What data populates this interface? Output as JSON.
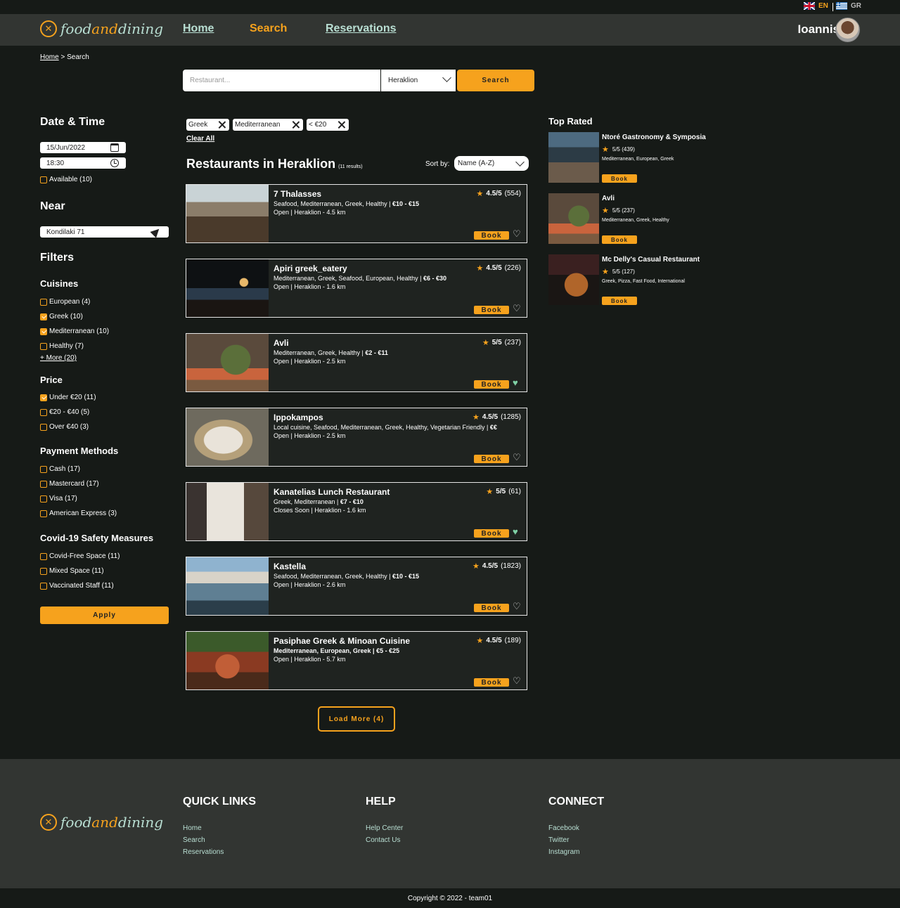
{
  "languages": [
    {
      "code": "EN",
      "active": true
    },
    {
      "code": "GR",
      "active": false
    }
  ],
  "header": {
    "logo": {
      "pre": "food",
      "mid": "and",
      "post": "dining"
    },
    "nav": [
      {
        "label": "Home",
        "active": false
      },
      {
        "label": "Search",
        "active": true
      },
      {
        "label": "Reservations",
        "active": false
      }
    ],
    "user_name": "Ioannis"
  },
  "breadcrumb": {
    "home": "Home",
    "sep": " > ",
    "current": "Search"
  },
  "search": {
    "placeholder": "Restaurant...",
    "city": "Heraklion",
    "button": "Search"
  },
  "sidebar": {
    "datetime_title": "Date & Time",
    "date": "15/Jun/2022",
    "time": "18:30",
    "available": {
      "label": "Available (10)",
      "checked": false
    },
    "near_title": "Near",
    "near_value": "Kondilaki 71",
    "filters_title": "Filters",
    "cuisines_title": "Cuisines",
    "cuisines": [
      {
        "label": "European (4)",
        "checked": false
      },
      {
        "label": "Greek (10)",
        "checked": true
      },
      {
        "label": "Mediterranean (10)",
        "checked": true
      },
      {
        "label": "Healthy (7)",
        "checked": false
      }
    ],
    "more": "+ More (20)",
    "price_title": "Price",
    "prices": [
      {
        "label": "Under €20 (11)",
        "checked": true
      },
      {
        "label": "€20 - €40 (5)",
        "checked": false
      },
      {
        "label": "Over €40 (3)",
        "checked": false
      }
    ],
    "payment_title": "Payment Methods",
    "payments": [
      {
        "label": "Cash (17)",
        "checked": false
      },
      {
        "label": "Mastercard (17)",
        "checked": false
      },
      {
        "label": "Visa (17)",
        "checked": false
      },
      {
        "label": "American Express (3)",
        "checked": false
      }
    ],
    "covid_title": "Covid-19 Safety Measures",
    "covid": [
      {
        "label": "Covid-Free Space (11)",
        "checked": false
      },
      {
        "label": "Mixed Space (11)",
        "checked": false
      },
      {
        "label": "Vaccinated Staff (11)",
        "checked": false
      }
    ],
    "apply": "Apply"
  },
  "chips": [
    "Greek",
    "Mediterranean",
    "< €20"
  ],
  "clear_all": "Clear All",
  "results": {
    "title": "Restaurants in Heraklion",
    "count": "(11 results)",
    "sort_label": "Sort by:",
    "sort_value": "Name (A-Z)"
  },
  "restaurants": [
    {
      "name": "7 Thalasses",
      "cats": "Seafood, Mediterranean, Greek, Healthy | ",
      "price": "€10 - €15",
      "status": "Open | Heraklion - 4.5 km",
      "score": "4.5/5",
      "reviews": "(554)",
      "fav": false
    },
    {
      "name": "Apiri greek_eatery",
      "cats": "Mediterranean, Greek, Seafood, European, Healthy | ",
      "price": "€6 - €30",
      "status": "Open | Heraklion - 1.6 km",
      "score": "4.5/5",
      "reviews": "(226)",
      "fav": false
    },
    {
      "name": "Avli",
      "cats": "Mediterranean, Greek, Healthy | ",
      "price": "€2 - €11",
      "status": "Open | Heraklion - 2.5 km",
      "score": "5/5",
      "reviews": "(237)",
      "fav": true
    },
    {
      "name": "Ippokampos",
      "cats": "Local cuisine, Seafood, Mediterranean, Greek, Healthy, Vegetarian Friendly | ",
      "price": "€€",
      "status": "Open | Heraklion - 2.5 km",
      "score": "4.5/5",
      "reviews": "(1285)",
      "fav": false
    },
    {
      "name": "Kanatelias Lunch Restaurant",
      "cats": "Greek, Mediterranean | ",
      "price": "€7 - €10",
      "status": "Closes Soon | Heraklion - 1.6 km",
      "score": "5/5",
      "reviews": "(61)",
      "fav": true
    },
    {
      "name": "Kastella",
      "cats": "Seafood, Mediterranean, Greek, Healthy | ",
      "price": "€10 - €15",
      "status": "Open | Heraklion - 2.6 km",
      "score": "4.5/5",
      "reviews": "(1823)",
      "fav": false
    },
    {
      "name": "Pasiphae Greek & Minoan Cuisine",
      "cats": "Mediterranean, European, Greek | ",
      "price": "€5 - €25",
      "status": "Open | Heraklion - 5.7 km",
      "score": "4.5/5",
      "reviews": "(189)",
      "fav": false
    }
  ],
  "book_label": "Book",
  "load_more": "Load More (4)",
  "top_rated": {
    "title": "Top Rated",
    "items": [
      {
        "name": "Ntoré Gastronomy & Symposia",
        "rating": "5/5 (439)",
        "cats": "Mediterranean, European, Greek"
      },
      {
        "name": "Avli",
        "rating": "5/5 (237)",
        "cats": "Mediterranean, Greek, Healthy"
      },
      {
        "name": "Mc Delly's Casual Restaurant",
        "rating": "5/5 (127)",
        "cats": "Greek, Pizza, Fast Food, International"
      }
    ]
  },
  "footer": {
    "quick_links_title": "QUICK LINKS",
    "quick_links": [
      "Home",
      "Search",
      "Reservations"
    ],
    "help_title": "HELP",
    "help_links": [
      "Help Center",
      "Contact Us"
    ],
    "connect_title": "CONNECT",
    "connect_links": [
      "Facebook",
      "Twitter",
      "Instagram"
    ],
    "copyright": "Copyright © 2022 - team01"
  },
  "colors": {
    "accent": "#f6a21d",
    "mint": "#b9dfd3",
    "bg": "#161a17",
    "panel": "#323532"
  }
}
